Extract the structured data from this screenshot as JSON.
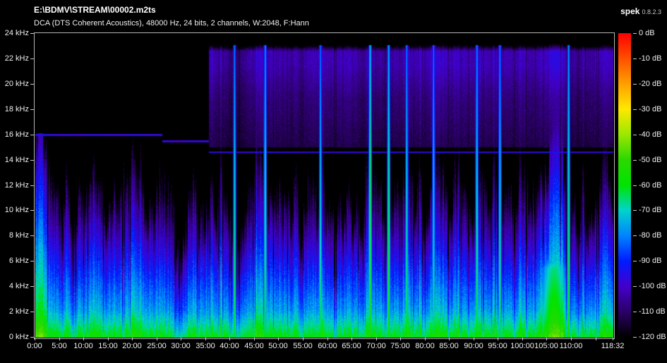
{
  "header": {
    "file_path": "E:\\BDMV\\STREAM\\00002.m2ts",
    "app_name": "spek",
    "app_version": "0.8.2.3",
    "codec_info": "DCA (DTS Coherent Acoustics), 48000 Hz, 24 bits, 2 channels, W:2048, F:Hann"
  },
  "axes": {
    "freq": {
      "unit": "kHz",
      "max_khz": 24,
      "labels": [
        "24 kHz",
        "22 kHz",
        "20 kHz",
        "18 kHz",
        "16 kHz",
        "14 kHz",
        "12 kHz",
        "10 kHz",
        "8 kHz",
        "6 kHz",
        "4 kHz",
        "2 kHz",
        "0 kHz"
      ]
    },
    "time": {
      "duration_label": "118:32",
      "duration_seconds": 7112,
      "ticks": [
        {
          "label": "0:00",
          "min": 0
        },
        {
          "label": "5:00",
          "min": 5
        },
        {
          "label": "10:00",
          "min": 10
        },
        {
          "label": "15:00",
          "min": 15
        },
        {
          "label": "20:00",
          "min": 20
        },
        {
          "label": "25:00",
          "min": 25
        },
        {
          "label": "30:00",
          "min": 30
        },
        {
          "label": "35:00",
          "min": 35
        },
        {
          "label": "40:00",
          "min": 40
        },
        {
          "label": "45:00",
          "min": 45
        },
        {
          "label": "50:00",
          "min": 50
        },
        {
          "label": "55:00",
          "min": 55
        },
        {
          "label": "60:00",
          "min": 60
        },
        {
          "label": "65:00",
          "min": 65
        },
        {
          "label": "70:00",
          "min": 70
        },
        {
          "label": "75:00",
          "min": 75
        },
        {
          "label": "80:00",
          "min": 80
        },
        {
          "label": "85:00",
          "min": 85
        },
        {
          "label": "90:00",
          "min": 90
        },
        {
          "label": "95:00",
          "min": 95
        },
        {
          "label": "100:00",
          "min": 100
        },
        {
          "label": "105:00",
          "min": 105
        },
        {
          "label": "110:00",
          "min": 110
        },
        {
          "label": "",
          "min": 115
        },
        {
          "label": "118:32",
          "min": 118.533
        }
      ]
    },
    "level": {
      "unit": "dB",
      "labels": [
        "0 dB",
        "-10 dB",
        "-20 dB",
        "-30 dB",
        "-40 dB",
        "-50 dB",
        "-60 dB",
        "-70 dB",
        "-80 dB",
        "-90 dB",
        "-100 dB",
        "-110 dB",
        "-120 dB"
      ],
      "palette": [
        "#ff0000",
        "#ff5000",
        "#ffa000",
        "#ffe800",
        "#9ce800",
        "#2cd800",
        "#00e400",
        "#00d4cc",
        "#0084ff",
        "#001cff",
        "#4400cc",
        "#2c0068",
        "#000000"
      ]
    }
  },
  "spectrogram": {
    "seed": 20481,
    "duration_min": 118.533,
    "intro_to_min": 2.3,
    "hf_cutoff_khz": 16.15,
    "cutoff_era_to_min": 35.5,
    "hlines": [
      {
        "from_min": 0,
        "to_min": 26,
        "khz": 16.0
      },
      {
        "from_min": 26,
        "to_min": 35.5,
        "khz": 15.5
      },
      {
        "from_min": 35.5,
        "to_min": 118.6,
        "khz": 14.65
      }
    ],
    "haze": {
      "from_min": 35.5,
      "from_khz": 15.05,
      "bright_from_khz": 19.0,
      "top_khz": 22.6
    },
    "spikes": [
      {
        "min": 40.8,
        "amp": 0.5
      },
      {
        "min": 47.1,
        "amp": 0.7
      },
      {
        "min": 58.4,
        "amp": 0.45
      },
      {
        "min": 68.6,
        "amp": 1.0
      },
      {
        "min": 72.4,
        "amp": 0.85
      },
      {
        "min": 76.1,
        "amp": 0.5
      },
      {
        "min": 81.6,
        "amp": 0.4
      },
      {
        "min": 90.5,
        "amp": 0.6
      },
      {
        "min": 95.2,
        "amp": 0.5
      },
      {
        "min": 109.3,
        "amp": 0.7
      }
    ],
    "blob": {
      "from_min": 103.8,
      "to_min": 108.8,
      "top_khz": 6.5
    },
    "section_gain": [
      [
        0,
        0.95
      ],
      [
        1.8,
        0.92
      ],
      [
        2.6,
        0.55
      ],
      [
        5,
        0.6
      ],
      [
        9,
        0.55
      ],
      [
        13,
        0.6
      ],
      [
        17,
        0.5
      ],
      [
        21,
        0.6
      ],
      [
        25,
        0.55
      ],
      [
        29,
        0.38
      ],
      [
        31,
        0.45
      ],
      [
        33,
        0.5
      ],
      [
        35.6,
        0.55
      ],
      [
        38,
        0.6
      ],
      [
        41,
        0.55
      ],
      [
        44,
        0.6
      ],
      [
        47,
        0.62
      ],
      [
        50,
        0.55
      ],
      [
        53,
        0.5
      ],
      [
        56,
        0.45
      ],
      [
        59,
        0.5
      ],
      [
        62,
        0.42
      ],
      [
        65,
        0.55
      ],
      [
        68,
        0.6
      ],
      [
        71,
        0.55
      ],
      [
        74,
        0.5
      ],
      [
        77,
        0.55
      ],
      [
        80,
        0.5
      ],
      [
        83,
        0.55
      ],
      [
        86,
        0.5
      ],
      [
        88,
        0.42
      ],
      [
        90,
        0.55
      ],
      [
        92,
        0.5
      ],
      [
        94,
        0.55
      ],
      [
        97,
        0.45
      ],
      [
        99,
        0.5
      ],
      [
        101,
        0.55
      ],
      [
        103,
        0.7
      ],
      [
        104.5,
        0.95
      ],
      [
        106,
        1.0
      ],
      [
        107.5,
        0.95
      ],
      [
        109,
        0.7
      ],
      [
        110,
        0.55
      ],
      [
        112,
        0.5
      ],
      [
        114,
        0.55
      ],
      [
        116,
        0.6
      ],
      [
        117.5,
        0.68
      ],
      [
        118.5,
        0.6
      ]
    ]
  }
}
